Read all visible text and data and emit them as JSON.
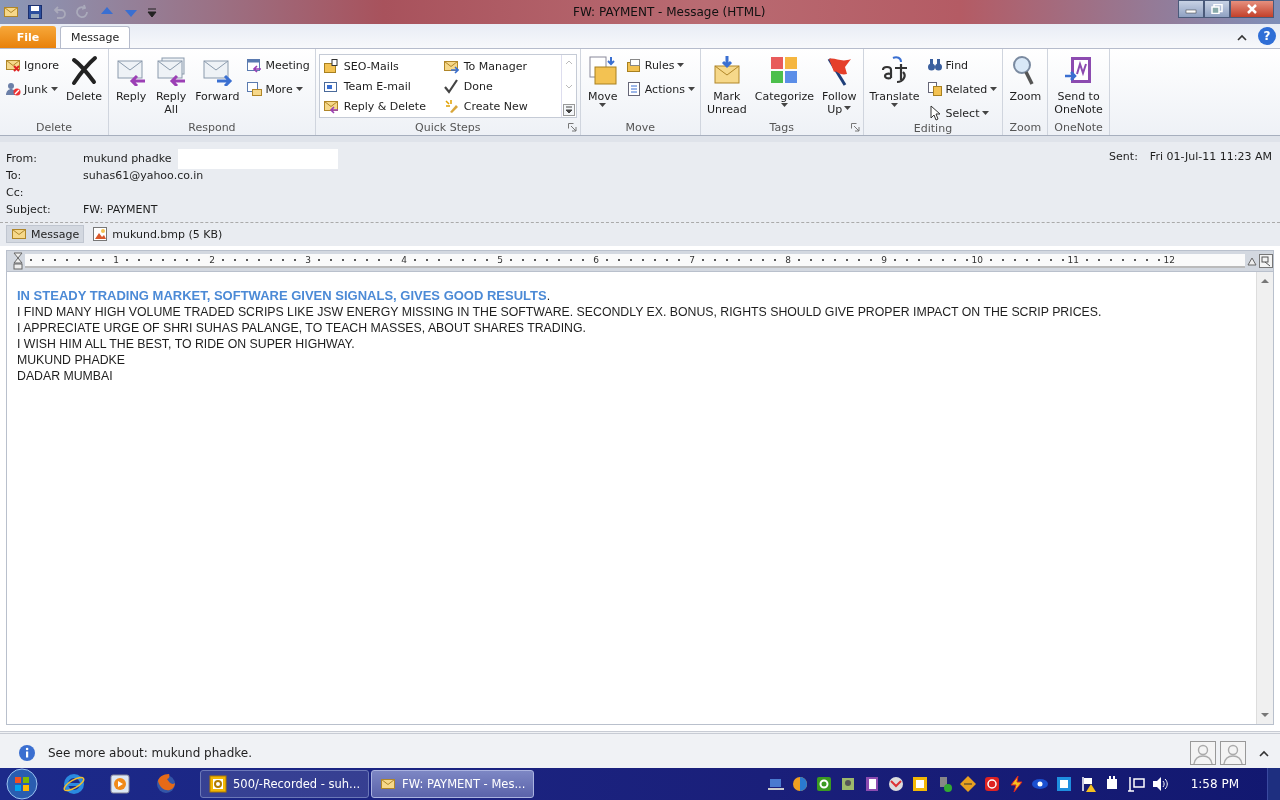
{
  "window": {
    "title": "FW: PAYMENT  -  Message (HTML)"
  },
  "ribbon_tabs": [
    {
      "label": "File",
      "kind": "file",
      "selected": false
    },
    {
      "label": "Message",
      "kind": "tab",
      "selected": true
    }
  ],
  "help_button": "?",
  "ribbon_groups": [
    {
      "label": "Delete",
      "launcher": false,
      "columns": [
        {
          "kind": "small",
          "items": [
            {
              "label": "Ignore",
              "dropdown": false
            },
            {
              "label": "Junk",
              "dropdown": true
            }
          ]
        },
        {
          "kind": "large",
          "lines": [
            "Delete"
          ],
          "dropdown": false
        }
      ]
    },
    {
      "label": "Respond",
      "launcher": false,
      "columns": [
        {
          "kind": "large",
          "lines": [
            "Reply"
          ],
          "dropdown": false
        },
        {
          "kind": "large",
          "lines": [
            "Reply",
            "All"
          ],
          "dropdown": false
        },
        {
          "kind": "large",
          "lines": [
            "Forward"
          ],
          "dropdown": false
        },
        {
          "kind": "small",
          "items": [
            {
              "label": "Meeting",
              "dropdown": false
            },
            {
              "label": "More",
              "dropdown": true
            }
          ]
        }
      ]
    },
    {
      "label": "Quick Steps",
      "launcher": true,
      "columns": [
        {
          "kind": "gallery",
          "items": [
            {
              "label": "SEO-Mails"
            },
            {
              "label": "To Manager"
            },
            {
              "label": "Team E-mail"
            },
            {
              "label": "Done"
            },
            {
              "label": "Reply & Delete"
            },
            {
              "label": "Create New"
            }
          ]
        }
      ]
    },
    {
      "label": "Move",
      "launcher": false,
      "columns": [
        {
          "kind": "large",
          "lines": [
            "Move"
          ],
          "dropdown": true
        },
        {
          "kind": "small",
          "items": [
            {
              "label": "Rules",
              "dropdown": true
            },
            {
              "label": "Actions",
              "dropdown": true
            }
          ]
        }
      ]
    },
    {
      "label": "Tags",
      "launcher": true,
      "columns": [
        {
          "kind": "large",
          "lines": [
            "Mark",
            "Unread"
          ],
          "dropdown": false
        },
        {
          "kind": "large",
          "lines": [
            "Categorize"
          ],
          "dropdown": true
        },
        {
          "kind": "large",
          "lines": [
            "Follow",
            "Up"
          ],
          "dropdown": true
        }
      ]
    },
    {
      "label": "Editing",
      "launcher": false,
      "columns": [
        {
          "kind": "large",
          "lines": [
            "Translate"
          ],
          "dropdown": true
        },
        {
          "kind": "small",
          "items": [
            {
              "label": "Find",
              "dropdown": false
            },
            {
              "label": "Related",
              "dropdown": true
            },
            {
              "label": "Select",
              "dropdown": true
            }
          ]
        }
      ]
    },
    {
      "label": "Zoom",
      "launcher": false,
      "columns": [
        {
          "kind": "large",
          "lines": [
            "Zoom"
          ],
          "dropdown": false
        }
      ]
    },
    {
      "label": "OneNote",
      "launcher": false,
      "columns": [
        {
          "kind": "large",
          "lines": [
            "Send to",
            "OneNote"
          ],
          "dropdown": false
        }
      ]
    }
  ],
  "header": {
    "fields": [
      {
        "label": "From:",
        "value": "mukund phadke"
      },
      {
        "label": "To:",
        "value": "suhas61@yahoo.co.in"
      },
      {
        "label": "Cc:"
      },
      {
        "label": "Subject:",
        "value": "FW: PAYMENT"
      }
    ],
    "sent": {
      "label": "Sent:",
      "value": "Fri 01-Jul-11 11:23 AM"
    }
  },
  "attachments": [
    {
      "label": "Message",
      "kind": "message",
      "selected": true
    },
    {
      "label": "mukund.bmp (5 KB)",
      "kind": "file",
      "selected": false
    }
  ],
  "ruler_marks": [
    "1",
    "2",
    "3",
    "4",
    "5",
    "6",
    "7",
    "8",
    "9",
    "10",
    "11",
    "12"
  ],
  "body": [
    {
      "text": "**IN STEADY TRADING MARKET, SOFTWARE GIVEN SIGNALS, GIVES GOOD RESULTS**.",
      "kind": "highlight"
    },
    {
      "text": "I FIND MANY HIGH VOLUME TRADED SCRIPS LIKE JSW ENERGY MISSING IN THE SOFTWARE. SECONDLY EX. BONUS, RIGHTS SHOULD GIVE PROPER IMPACT ON THE SCRIP PRICES.",
      "kind": "plain"
    },
    {
      "text": "I APPRECIATE URGE OF SHRI SUHAS PALANGE, TO TEACH MASSES, ABOUT SHARES TRADING.",
      "kind": "plain"
    },
    {
      "text": "I WISH HIM ALL THE BEST, TO RIDE ON SUPER HIGHWAY.",
      "kind": "plain"
    },
    {
      "text": "MUKUND PHADKE",
      "kind": "plain"
    },
    {
      "text": "DADAR MUMBAI",
      "kind": "plain"
    }
  ],
  "info_bar": {
    "text": "See more about: mukund phadke."
  },
  "taskbar": {
    "tasks": [
      {
        "label": "500/-Recorded - suh...",
        "kind": "outlook",
        "selected": false
      },
      {
        "label": "FW: PAYMENT - Mes...",
        "kind": "mail",
        "selected": true
      }
    ],
    "clock": "1:58 PM"
  }
}
